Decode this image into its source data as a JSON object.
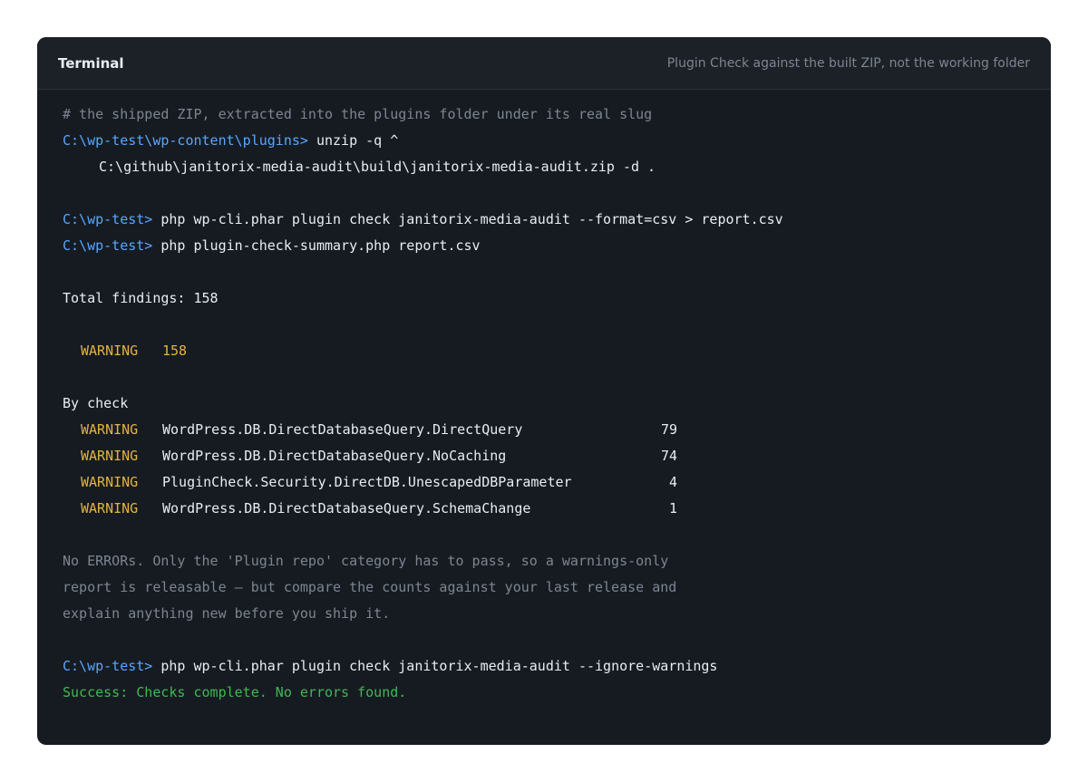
{
  "header": {
    "title": "Terminal",
    "subtitle": "Plugin Check against the built ZIP, not the working folder"
  },
  "session": {
    "comment": "# the shipped ZIP, extracted into the plugins folder under its real slug",
    "cmd1": {
      "prompt": "C:\\wp-test\\wp-content\\plugins>",
      "command": "unzip -q ^",
      "continuation": "C:\\github\\janitorix-media-audit\\build\\janitorix-media-audit.zip -d ."
    },
    "cmd2": {
      "prompt": "C:\\wp-test>",
      "command": "php wp-cli.phar plugin check janitorix-media-audit --format=csv > report.csv"
    },
    "cmd3": {
      "prompt": "C:\\wp-test>",
      "command": "php plugin-check-summary.php report.csv"
    },
    "total": "Total findings: 158",
    "summary": {
      "level": "WARNING",
      "count": "158"
    },
    "by_check_label": "By check",
    "checks": [
      {
        "level": "WARNING",
        "check": "WordPress.DB.DirectDatabaseQuery.DirectQuery",
        "count": "79"
      },
      {
        "level": "WARNING",
        "check": "WordPress.DB.DirectDatabaseQuery.NoCaching",
        "count": "74"
      },
      {
        "level": "WARNING",
        "check": "PluginCheck.Security.DirectDB.UnescapedDBParameter",
        "count": "4"
      },
      {
        "level": "WARNING",
        "check": "WordPress.DB.DirectDatabaseQuery.SchemaChange",
        "count": "1"
      }
    ],
    "note": [
      "No ERRORs. Only the 'Plugin repo' category has to pass, so a warnings-only",
      "report is releasable — but compare the counts against your last release and",
      "explain anything new before you ship it."
    ],
    "cmd4": {
      "prompt": "C:\\wp-test>",
      "command": "php wp-cli.phar plugin check janitorix-media-audit --ignore-warnings"
    },
    "success": "Success: Checks complete. No errors found."
  },
  "colors": {
    "background": "#161b22",
    "prompt": "#58a6ff",
    "warning": "#e3b341",
    "success": "#3fb950",
    "muted": "#7d8590"
  }
}
